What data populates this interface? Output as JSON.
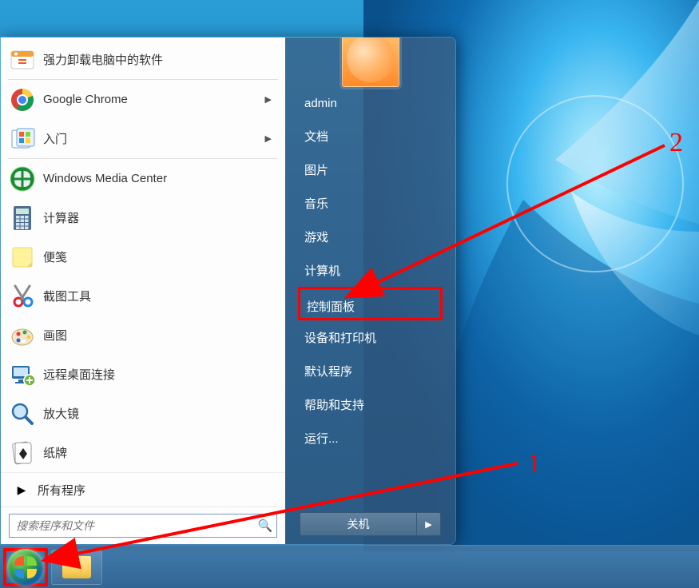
{
  "start_menu": {
    "programs": [
      {
        "label": "强力卸载电脑中的软件",
        "icon": "uninstall",
        "arrow": false
      },
      {
        "label": "Google Chrome",
        "icon": "chrome",
        "arrow": true
      },
      {
        "label": "入门",
        "icon": "getting-started",
        "arrow": true
      },
      {
        "label": "Windows Media Center",
        "icon": "wmc",
        "arrow": false
      },
      {
        "label": "计算器",
        "icon": "calculator",
        "arrow": false
      },
      {
        "label": "便笺",
        "icon": "sticky-notes",
        "arrow": false
      },
      {
        "label": "截图工具",
        "icon": "snipping",
        "arrow": false
      },
      {
        "label": "画图",
        "icon": "paint",
        "arrow": false
      },
      {
        "label": "远程桌面连接",
        "icon": "remote-desktop",
        "arrow": false
      },
      {
        "label": "放大镜",
        "icon": "magnifier",
        "arrow": false
      },
      {
        "label": "纸牌",
        "icon": "solitaire",
        "arrow": false
      }
    ],
    "all_programs": "所有程序",
    "search_placeholder": "搜索程序和文件",
    "right_links": [
      "admin",
      "文档",
      "图片",
      "音乐",
      "游戏",
      "计算机",
      "控制面板",
      "设备和打印机",
      "默认程序",
      "帮助和支持",
      "运行..."
    ],
    "highlighted_link_index": 6,
    "shutdown": "关机"
  },
  "annotation": {
    "num1": "1",
    "num2": "2"
  }
}
